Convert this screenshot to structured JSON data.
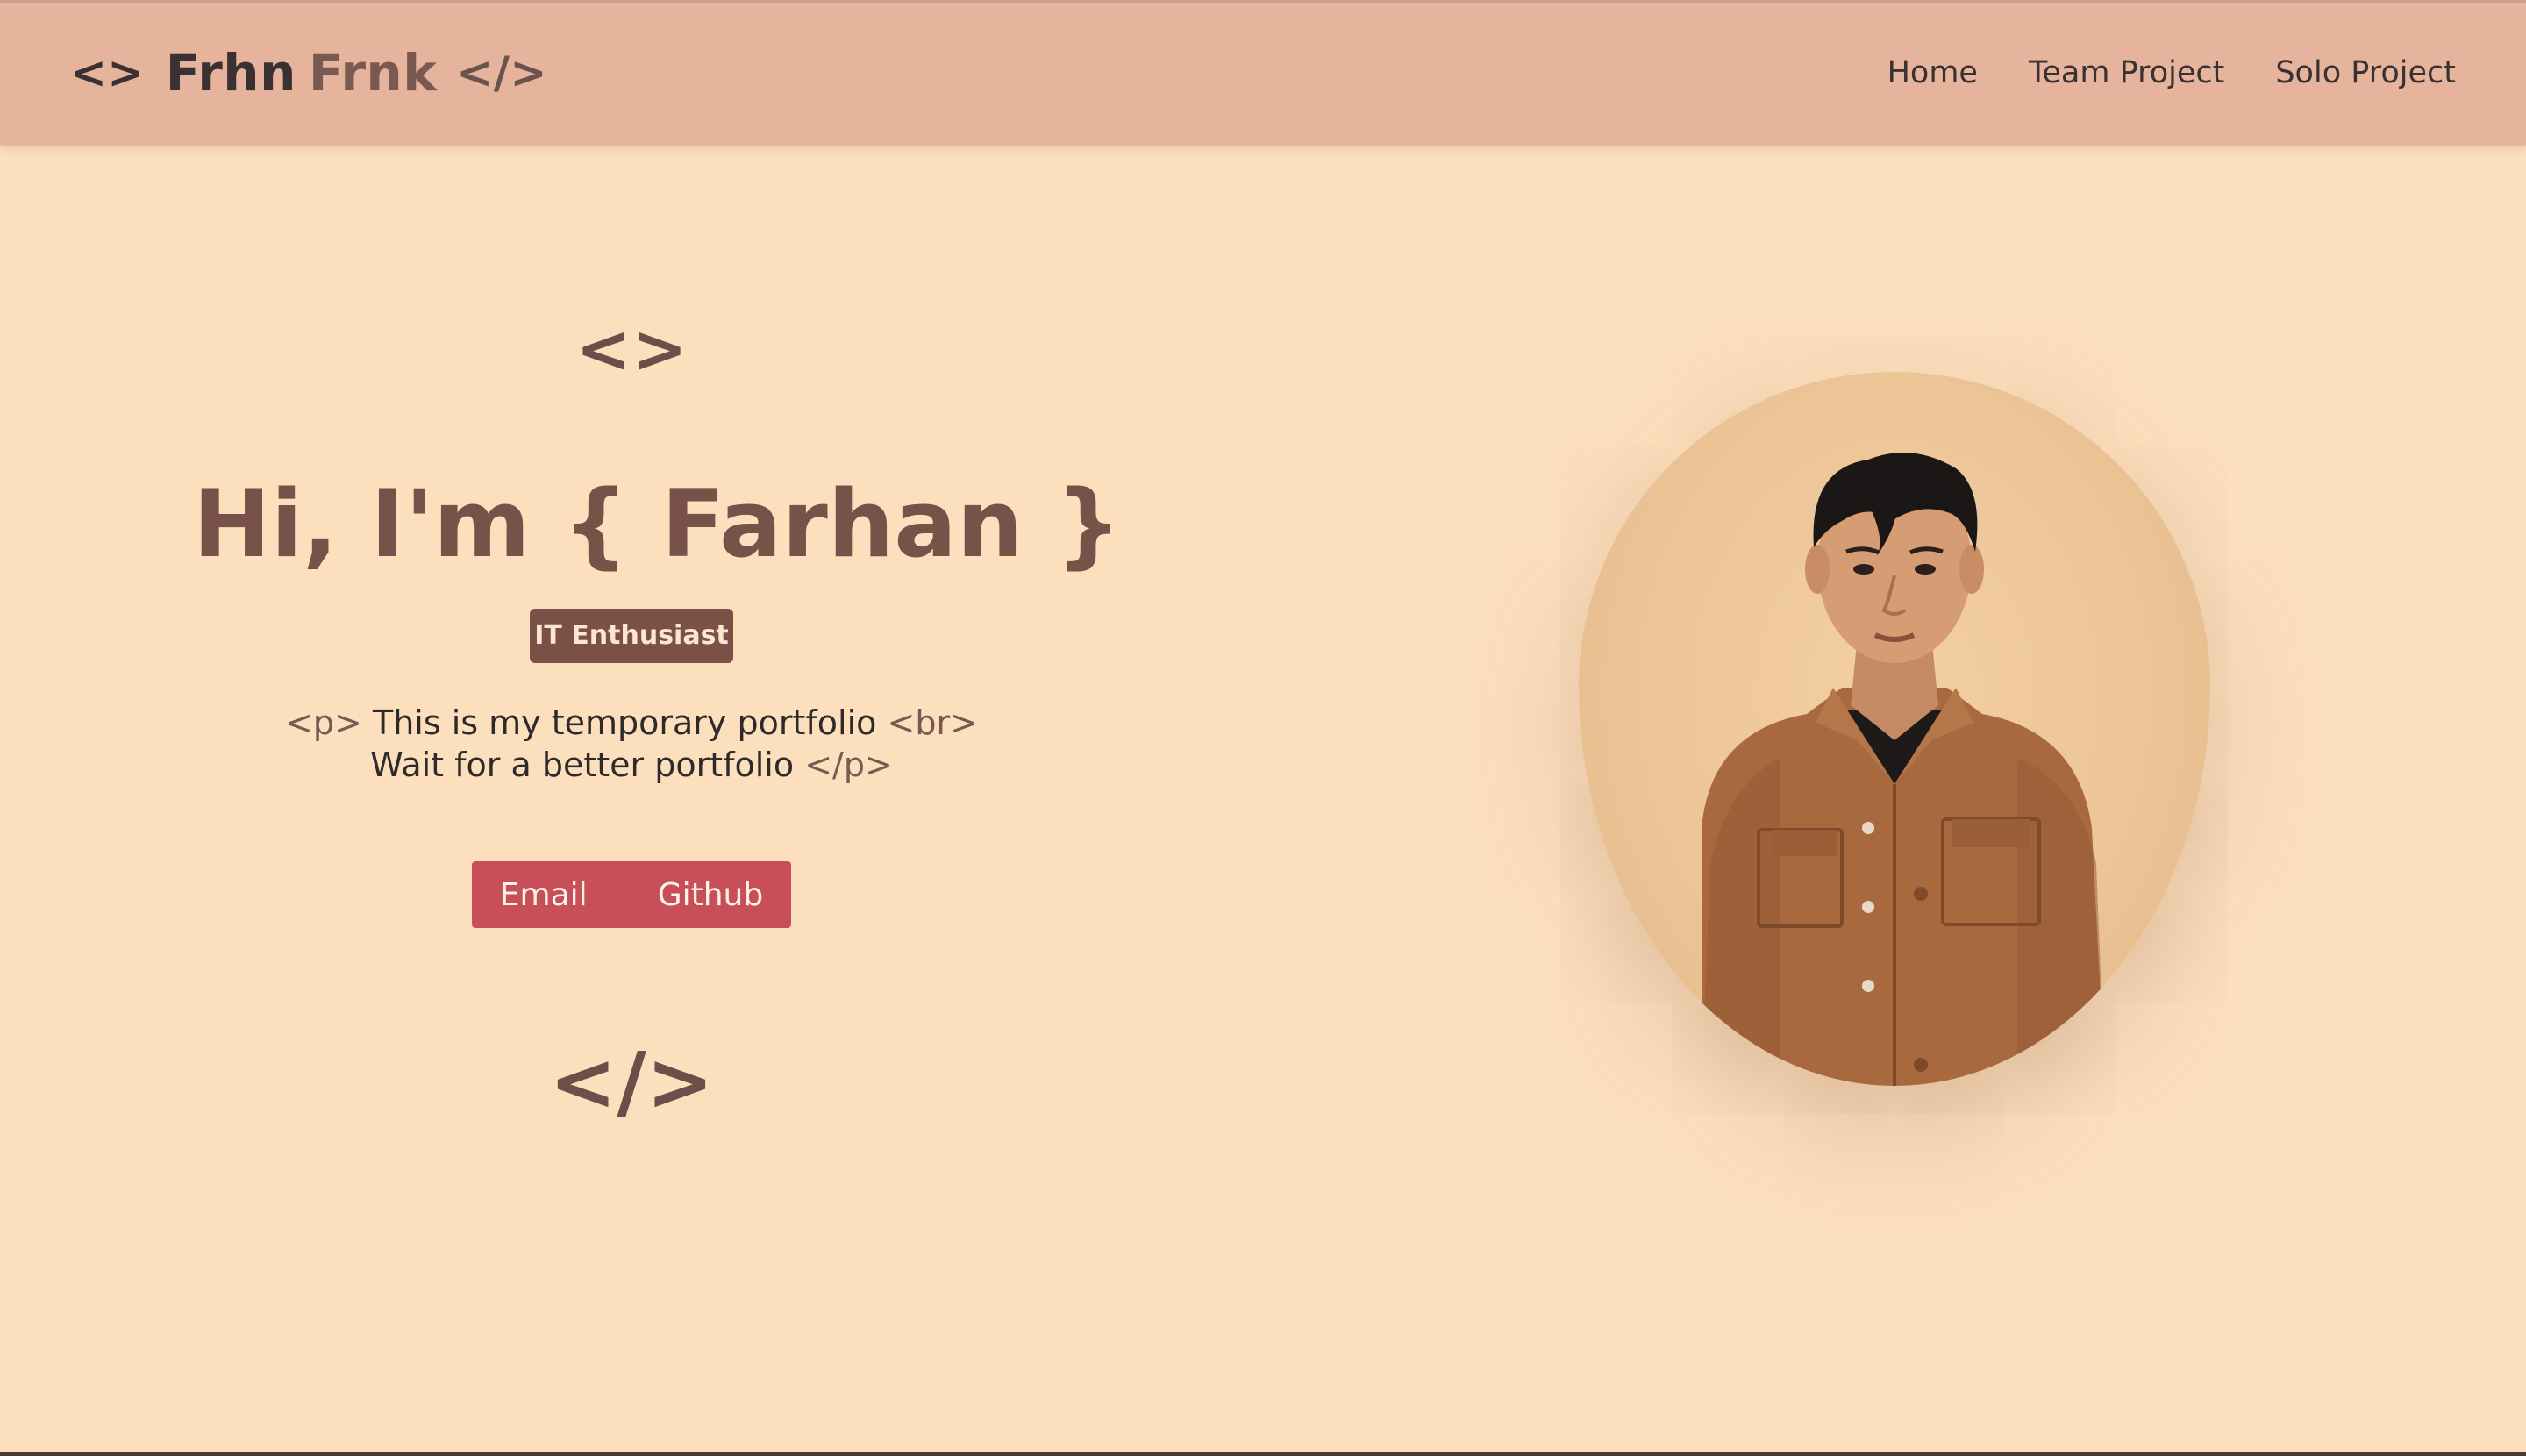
{
  "navbar": {
    "brand": {
      "open_code": "<>",
      "name_primary": "Frhn",
      "name_secondary": "Frnk",
      "close_code": "</>"
    },
    "links": [
      "Home",
      "Team Project",
      "Solo Project"
    ]
  },
  "hero": {
    "bracket_open": "<>",
    "title": "Hi, I'm { Farhan }",
    "badge": "IT Enthusiast",
    "description": {
      "tag_open_p": "<p>",
      "line1": "This is my temporary portfolio",
      "tag_br": "<br>",
      "line2": "Wait for a better portfolio",
      "tag_close_p": "</p>"
    },
    "buttons": {
      "email": "Email",
      "github": "Github"
    },
    "bracket_close": "</>"
  },
  "portrait": {
    "subject": "young man in brown button-up jacket over black tee"
  },
  "colors": {
    "page_bg": "#fcdfbd",
    "navbar_bg": "#e6b39c",
    "title": "#785148",
    "badge_bg": "#7a5047",
    "button_bg": "#c84f57"
  }
}
